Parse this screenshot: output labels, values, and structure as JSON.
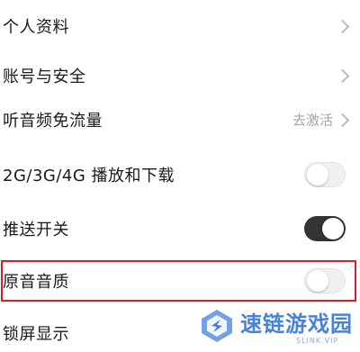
{
  "settings": {
    "items": [
      {
        "label": "个人资料"
      },
      {
        "label": "账号与安全"
      },
      {
        "label": "听音频免流量",
        "value": "去激活"
      },
      {
        "label": "2G/3G/4G 播放和下载",
        "toggle": false
      },
      {
        "label": "推送开关",
        "toggle": true
      },
      {
        "label": "原音音质",
        "toggle": false,
        "highlighted": true
      },
      {
        "label": "锁屏显示"
      }
    ]
  },
  "watermark": {
    "name": "速链游戏园",
    "url": "SLINK.VIP"
  },
  "colors": {
    "highlight_border": "#d4202a",
    "toggle_on": "#333333",
    "toggle_off": "#f0f0f0",
    "watermark": "#3f7cd8"
  }
}
